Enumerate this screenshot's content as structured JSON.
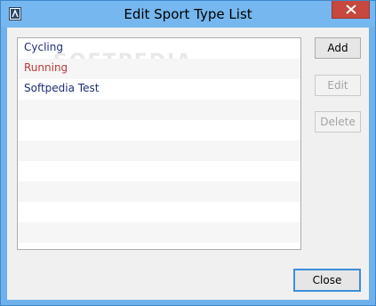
{
  "window": {
    "title": "Edit Sport Type List",
    "accent_color": "#6fb1ea",
    "close_button_color": "#c7483e"
  },
  "list": {
    "items": [
      {
        "label": "Cycling",
        "color": "#1f2d78"
      },
      {
        "label": "Running",
        "color": "#bd3a3a"
      },
      {
        "label": "Softpedia Test",
        "color": "#1f2d78"
      }
    ],
    "watermark": "SOFTPEDIA"
  },
  "buttons": {
    "add": "Add",
    "edit": "Edit",
    "delete": "Delete",
    "close": "Close"
  },
  "icons": {
    "app": "app-icon",
    "close": "close-icon"
  }
}
